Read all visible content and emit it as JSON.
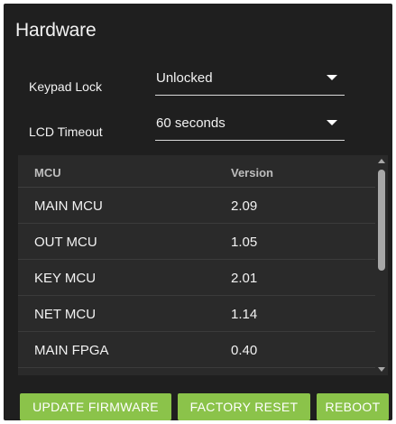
{
  "panel": {
    "title": "Hardware"
  },
  "fields": {
    "keypad_lock": {
      "label": "Keypad Lock",
      "value": "Unlocked"
    },
    "lcd_timeout": {
      "label": "LCD Timeout",
      "value": "60 seconds"
    }
  },
  "table": {
    "headers": {
      "mcu": "MCU",
      "version": "Version"
    },
    "rows": [
      {
        "mcu": "MAIN MCU",
        "version": "2.09"
      },
      {
        "mcu": "OUT MCU",
        "version": "1.05"
      },
      {
        "mcu": "KEY MCU",
        "version": "2.01"
      },
      {
        "mcu": "NET MCU",
        "version": "1.14"
      },
      {
        "mcu": "MAIN FPGA",
        "version": "0.40"
      }
    ]
  },
  "buttons": {
    "update_firmware": "UPDATE FIRMWARE",
    "factory_reset": "FACTORY RESET",
    "reboot": "REBOOT"
  },
  "colors": {
    "panel_bg": "#1f1f1f",
    "table_bg": "#2a2a2a",
    "button_green": "#8bc34a"
  }
}
